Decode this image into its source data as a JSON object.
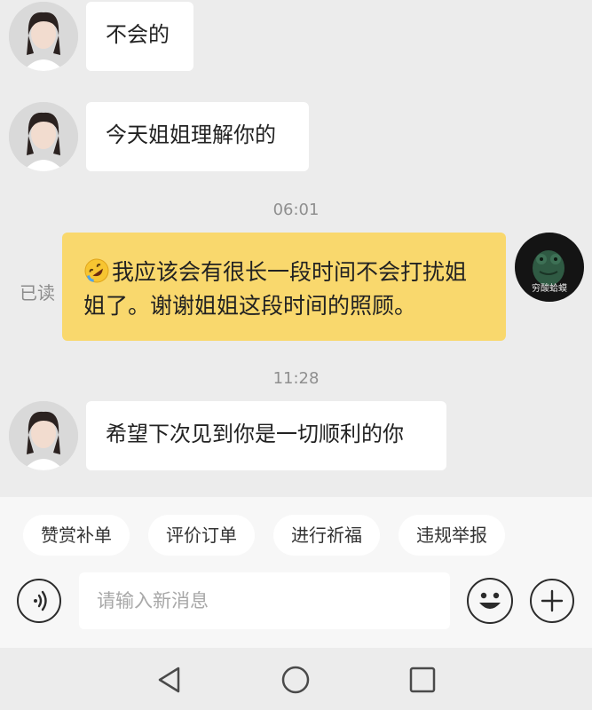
{
  "messages": [
    {
      "side": "left",
      "text": "不会的"
    },
    {
      "side": "left",
      "text": "今天姐姐理解你的"
    },
    {
      "type": "time",
      "text": "06:01"
    },
    {
      "side": "right",
      "emoji": "rolling-on-floor-laughing",
      "text": "我应该会有很长一段时间不会打扰姐姐了。谢谢姐姐这段时间的照顾。",
      "read_status": "已读",
      "avatar_caption": "穷酸蛤蟆"
    },
    {
      "type": "time",
      "text": "11:28"
    },
    {
      "side": "left",
      "text": "希望下次见到你是一切顺利的你"
    }
  ],
  "quick_actions": [
    "赞赏补单",
    "评价订单",
    "进行祈福",
    "违规举报"
  ],
  "input": {
    "placeholder": "请输入新消息"
  },
  "icons": {
    "voice": "voice-icon",
    "emoji": "emoji-icon",
    "plus": "plus-icon",
    "back": "back-triangle-icon",
    "home": "home-circle-icon",
    "recents": "recents-square-icon"
  },
  "colors": {
    "mine_bubble": "#f9d86d",
    "bubble": "#ffffff",
    "background": "#ececec"
  }
}
